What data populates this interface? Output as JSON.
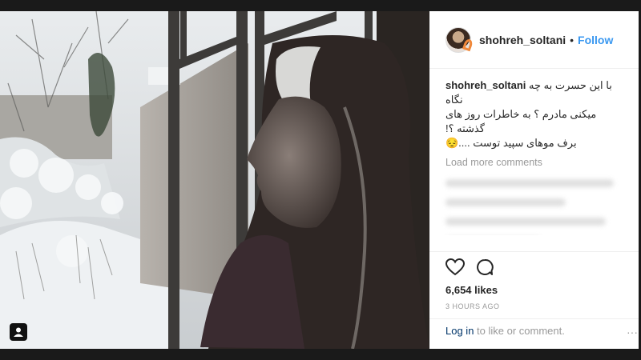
{
  "post": {
    "username": "shohreh_soltani",
    "follow_label": "Follow",
    "separator": "•",
    "caption_user": "shohreh_soltani",
    "caption_lines": [
      "با این حسرت به چه نگاه",
      "میکنی مادرم ؟ به خاطرات روز های گذشته ؟!",
      "برف موهای سپید توست ....😔"
    ],
    "load_more": "Load more comments",
    "likes": "6,654 likes",
    "time": "3 HOURS AGO",
    "login_link": "Log in",
    "login_suffix": " to like or comment.",
    "more_label": "···"
  },
  "icons": {
    "like": "heart-outline-icon",
    "comment": "speech-bubble-icon",
    "user_tag": "user-tag-icon"
  },
  "colors": {
    "link_blue": "#3897f0",
    "text": "#262626",
    "muted": "#999999"
  }
}
